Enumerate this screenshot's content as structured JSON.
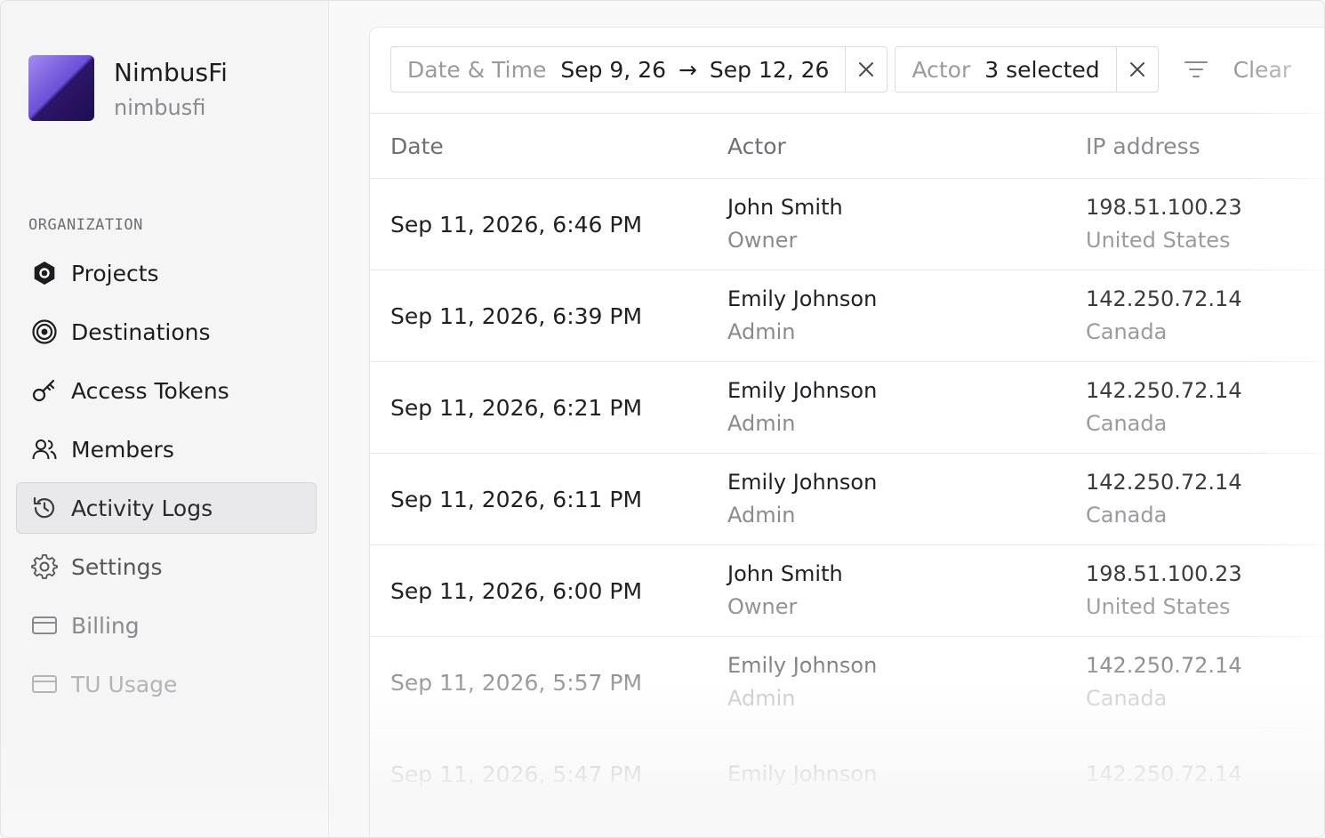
{
  "org": {
    "name": "NimbusFi",
    "slug": "nimbusfi"
  },
  "sidebar": {
    "section_label": "ORGANIZATION",
    "items": [
      {
        "label": "Projects",
        "icon": "hexagon-icon"
      },
      {
        "label": "Destinations",
        "icon": "target-icon"
      },
      {
        "label": "Access Tokens",
        "icon": "key-icon"
      },
      {
        "label": "Members",
        "icon": "users-icon"
      },
      {
        "label": "Activity Logs",
        "icon": "history-icon",
        "active": true
      },
      {
        "label": "Settings",
        "icon": "gear-icon"
      },
      {
        "label": "Billing",
        "icon": "card-icon"
      },
      {
        "label": "TU Usage",
        "icon": "card-icon"
      }
    ]
  },
  "filters": {
    "date": {
      "label": "Date & Time",
      "from": "Sep 9, 26",
      "arrow": "→",
      "to": "Sep 12, 26"
    },
    "actor": {
      "label": "Actor",
      "value": "3 selected"
    },
    "clear_label": "Clear"
  },
  "table": {
    "headers": {
      "date": "Date",
      "actor": "Actor",
      "ip": "IP address"
    },
    "rows": [
      {
        "date": "Sep 11, 2026, 6:46 PM",
        "actor": "John Smith",
        "role": "Owner",
        "ip": "198.51.100.23",
        "country": "United States"
      },
      {
        "date": "Sep 11, 2026, 6:39 PM",
        "actor": "Emily Johnson",
        "role": "Admin",
        "ip": "142.250.72.14",
        "country": "Canada"
      },
      {
        "date": "Sep 11, 2026, 6:21 PM",
        "actor": "Emily Johnson",
        "role": "Admin",
        "ip": "142.250.72.14",
        "country": "Canada"
      },
      {
        "date": "Sep 11, 2026, 6:11 PM",
        "actor": "Emily Johnson",
        "role": "Admin",
        "ip": "142.250.72.14",
        "country": "Canada"
      },
      {
        "date": "Sep 11, 2026, 6:00 PM",
        "actor": "John Smith",
        "role": "Owner",
        "ip": "198.51.100.23",
        "country": "United States"
      },
      {
        "date": "Sep 11, 2026, 5:57 PM",
        "actor": "Emily Johnson",
        "role": "Admin",
        "ip": "142.250.72.14",
        "country": "Canada"
      },
      {
        "date": "Sep 11, 2026, 5:47 PM",
        "actor": "Emily Johnson",
        "role": "",
        "ip": "142.250.72.14",
        "country": ""
      }
    ]
  }
}
